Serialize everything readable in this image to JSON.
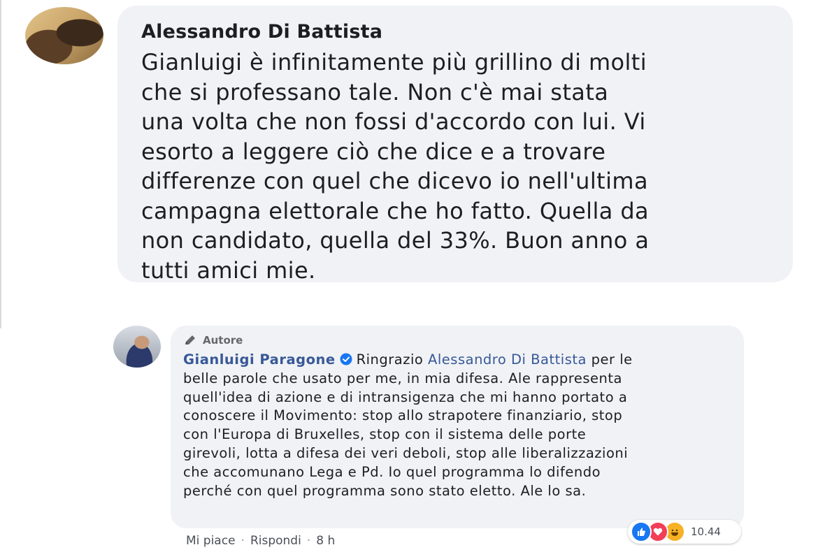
{
  "comment": {
    "author": "Alessandro Di Battista",
    "lines": [
      "Gianluigi è infinitamente più grillino di molti",
      "che si professano tale. Non c'è mai stata",
      "una volta che non fossi d'accordo con lui. Vi",
      "esorto a leggere ciò che dice e a trovare",
      "differenze con quel che dicevo io nell'ultima",
      "campagna elettorale che ho fatto. Quella da",
      "non candidato, quella del 33%. Buon anno a",
      "tutti amici mie."
    ]
  },
  "reply": {
    "badge_label": "Autore",
    "author": "Gianluigi Paragone",
    "prefix": "Ringrazio",
    "mention": "Alessandro Di Battista",
    "first_line_rest": "per le",
    "lines": [
      "belle parole che usato per me, in mia difesa. Ale rappresenta",
      "quell'idea di azione e di intransigenza che mi hanno portato a",
      "conoscere il Movimento: stop allo strapotere finanziario, stop",
      "con l'Europa di Bruxelles, stop con il sistema delle porte",
      "girevoli, lotta a difesa dei veri deboli, stop alle liberalizzazioni",
      "che accomunano Lega e Pd. Io quel programma lo difendo",
      "perché con quel programma sono stato eletto. Ale lo sa."
    ]
  },
  "actions": {
    "like": "Mi piace",
    "reply": "Rispondi",
    "time": "8 h",
    "separator": "·"
  },
  "reactions": {
    "icons": [
      "like-icon",
      "love-icon",
      "haha-icon"
    ],
    "count": "10.44"
  },
  "colors": {
    "bubble": "#f0f2f5",
    "link": "#385898",
    "like": "#1877f2",
    "love": "#f33e58",
    "haha": "#f7b125"
  }
}
